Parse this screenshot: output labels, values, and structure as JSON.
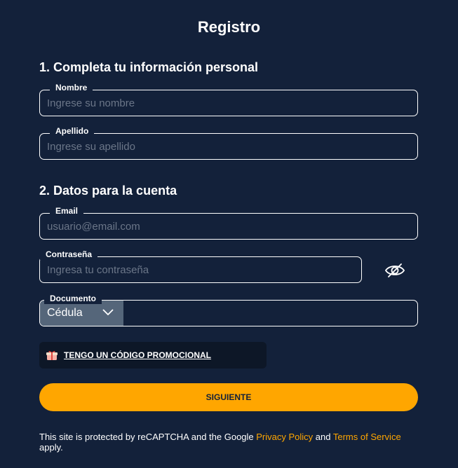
{
  "header": {
    "title": "Registro"
  },
  "section1": {
    "title": "1. Completa tu información personal",
    "nombre": {
      "label": "Nombre",
      "placeholder": "Ingrese su nombre"
    },
    "apellido": {
      "label": "Apellido",
      "placeholder": "Ingrese su apellido"
    }
  },
  "section2": {
    "title": "2. Datos para la cuenta",
    "email": {
      "label": "Email",
      "placeholder": "usuario@email.com"
    },
    "password": {
      "label": "Contraseña",
      "placeholder": "Ingresa tu contraseña",
      "toggle_icon": "eye-slash-icon"
    },
    "document": {
      "label": "Documento",
      "selected_type": "Cédula",
      "number_value": ""
    }
  },
  "promo": {
    "label": "TENGO UN CÓDIGO PROMOCIONAL",
    "icon": "gift-icon"
  },
  "submit": {
    "label": "SIGUIENTE"
  },
  "footer": {
    "text_before": "This site is protected by reCAPTCHA and the Google ",
    "privacy_link": "Privacy Policy",
    "text_middle": " and ",
    "terms_link": "Terms of Service",
    "text_after": " apply."
  },
  "colors": {
    "background": "#13213a",
    "accent": "#ffa600",
    "select_bg": "#55667a",
    "promo_bg": "#0d1727"
  }
}
